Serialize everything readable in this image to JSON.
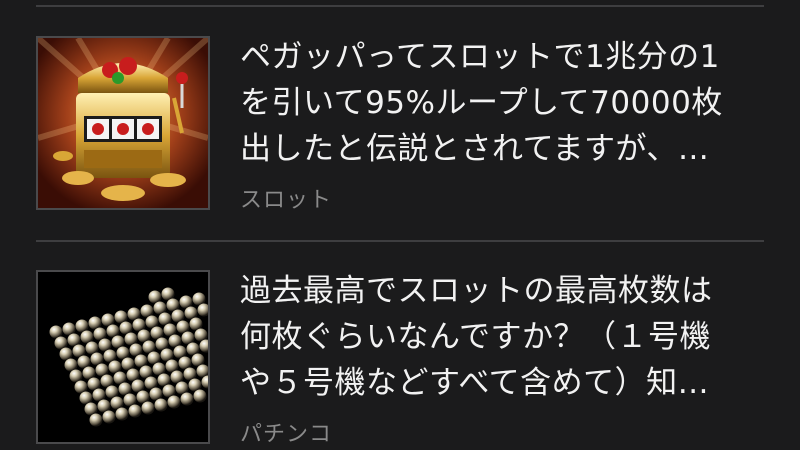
{
  "items": [
    {
      "title_lines": [
        "ペガッパってスロットで1兆分の1",
        "を引いて95%ループして70000枚",
        "出したと伝説とされてますが、…"
      ],
      "category": "スロット",
      "thumbnail_icon": "slot-machine-image"
    },
    {
      "title_lines": [
        "過去最高でスロットの最高枚数は",
        "何枚ぐらいなんですか？（１号機",
        "や５号機などすべて含めて）知…"
      ],
      "category": "パチンコ",
      "thumbnail_icon": "pachinko-balls-image"
    }
  ],
  "colors": {
    "background": "#1b1b1c",
    "title_text": "#f2f2f2",
    "category_text": "#8a8a8a",
    "divider": "#3e3e40"
  }
}
